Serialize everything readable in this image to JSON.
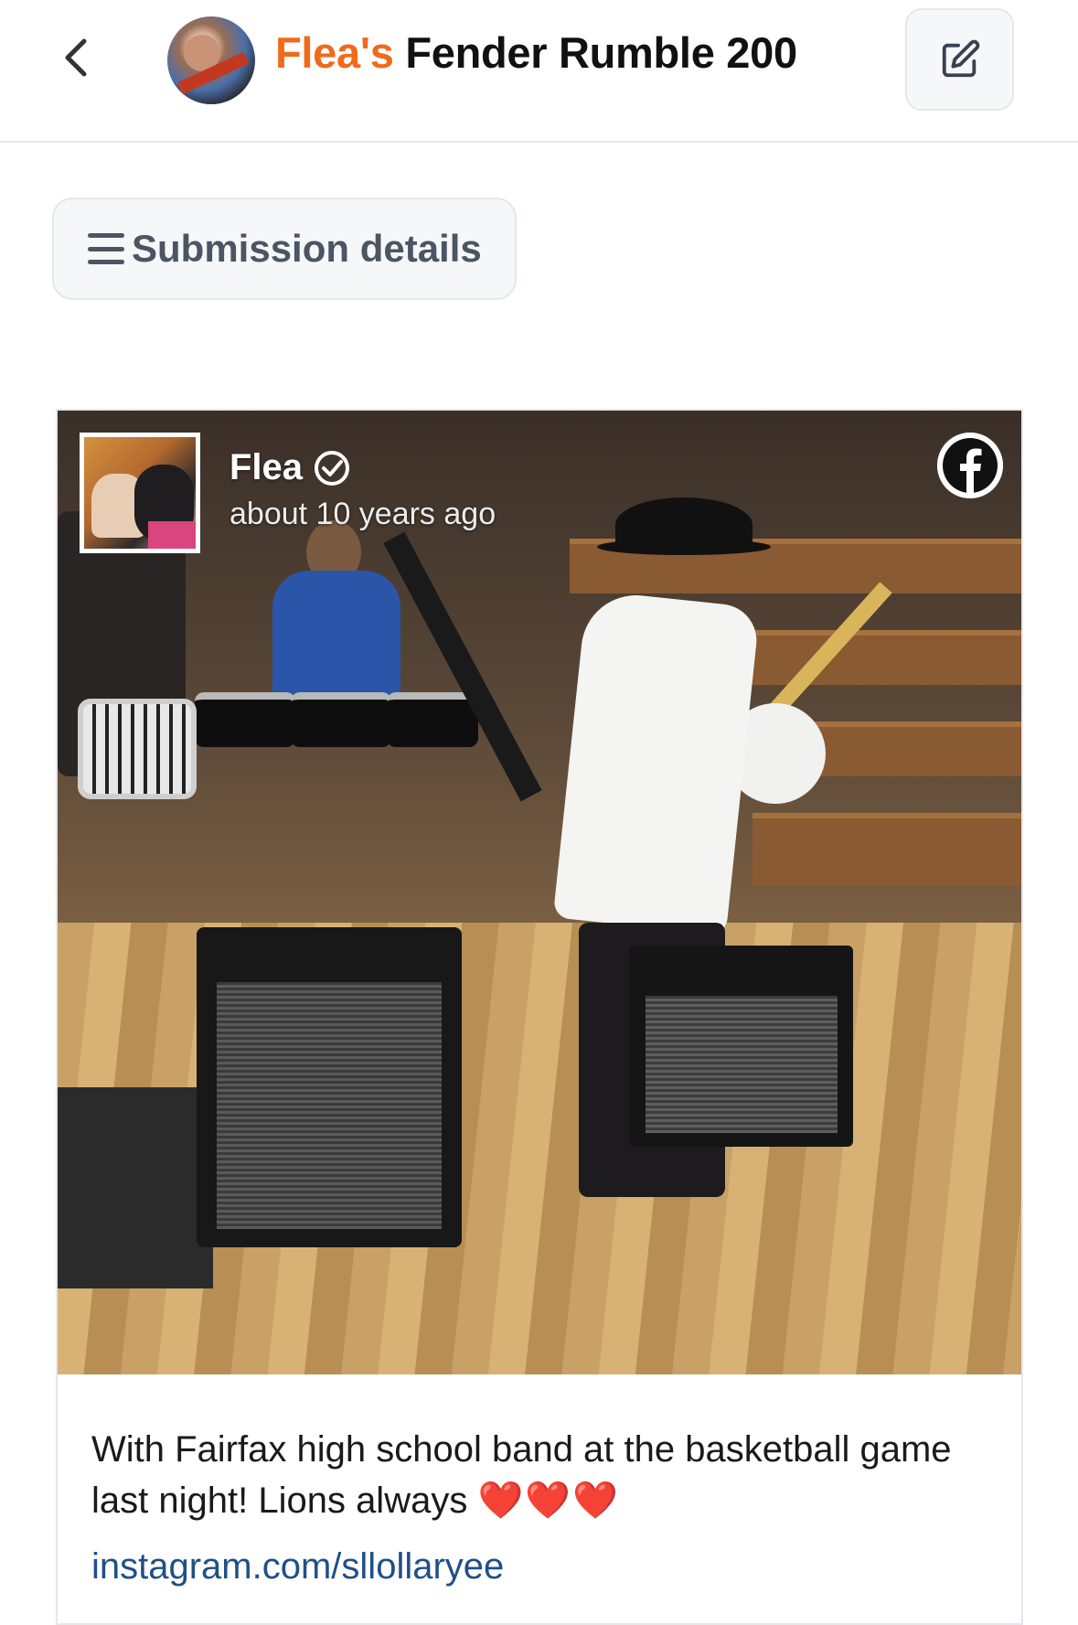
{
  "header": {
    "title_accent": "Flea's",
    "title_rest": "Fender Rumble 200",
    "back_icon": "chevron-left-icon",
    "edit_icon": "pencil-square-icon"
  },
  "details": {
    "label": "Submission details",
    "icon": "menu-icon"
  },
  "post": {
    "author": "Flea",
    "timestamp": "about 10 years ago",
    "platform_icon": "facebook-icon",
    "caption": "With Fairfax high school band at the basketball game last night! Lions always",
    "hearts": "❤️❤️❤️",
    "link": "instagram.com/sllollaryee"
  },
  "colors": {
    "accent": "#f06a1c",
    "link": "#1f4f8a",
    "button_bg": "#f6f7f8",
    "border": "#e5e7eb"
  }
}
